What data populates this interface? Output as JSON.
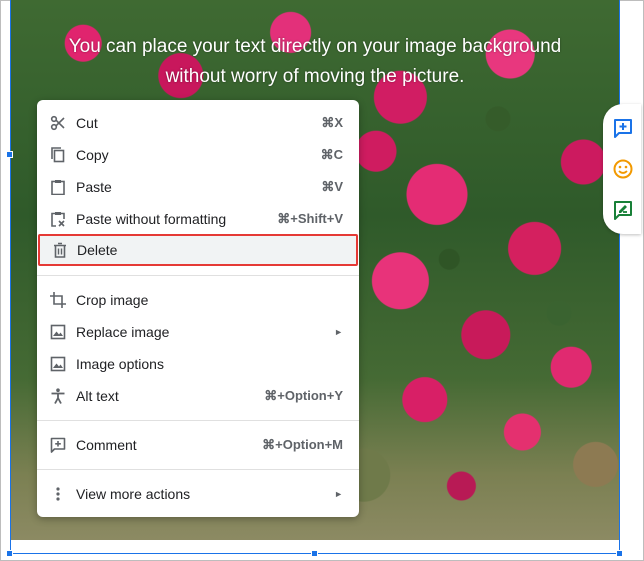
{
  "caption": {
    "line1": "You can place your text directly on your image background",
    "line2": "without worry of moving the picture."
  },
  "context_menu": {
    "items": [
      {
        "label": "Cut",
        "shortcut": "⌘X",
        "icon": "scissors-icon"
      },
      {
        "label": "Copy",
        "shortcut": "⌘C",
        "icon": "copy-icon"
      },
      {
        "label": "Paste",
        "shortcut": "⌘V",
        "icon": "clipboard-icon"
      },
      {
        "label": "Paste without formatting",
        "shortcut": "⌘+Shift+V",
        "icon": "clipboard-clear-icon"
      },
      {
        "label": "Delete",
        "shortcut": "",
        "icon": "trash-icon",
        "highlighted": true
      },
      {
        "label": "Crop image",
        "shortcut": "",
        "icon": "crop-icon"
      },
      {
        "label": "Replace image",
        "shortcut": "",
        "icon": "image-icon",
        "submenu": true
      },
      {
        "label": "Image options",
        "shortcut": "",
        "icon": "image-icon"
      },
      {
        "label": "Alt text",
        "shortcut": "⌘+Option+Y",
        "icon": "accessibility-icon"
      },
      {
        "label": "Comment",
        "shortcut": "⌘+Option+M",
        "icon": "comment-add-icon"
      },
      {
        "label": "View more actions",
        "shortcut": "",
        "icon": "more-vert-icon",
        "submenu": true
      }
    ],
    "submenu_arrow": "►"
  },
  "side_toolbar": {
    "buttons": [
      {
        "icon": "add-comment-icon",
        "color": "#1a73e8"
      },
      {
        "icon": "emoji-icon",
        "color": "#f29900"
      },
      {
        "icon": "suggest-edit-icon",
        "color": "#188038"
      }
    ]
  },
  "colors": {
    "selection": "#1a73e8",
    "highlight_border": "#e53935",
    "flower_pink": "#e0246e",
    "foliage_green": "#3f6a32"
  }
}
